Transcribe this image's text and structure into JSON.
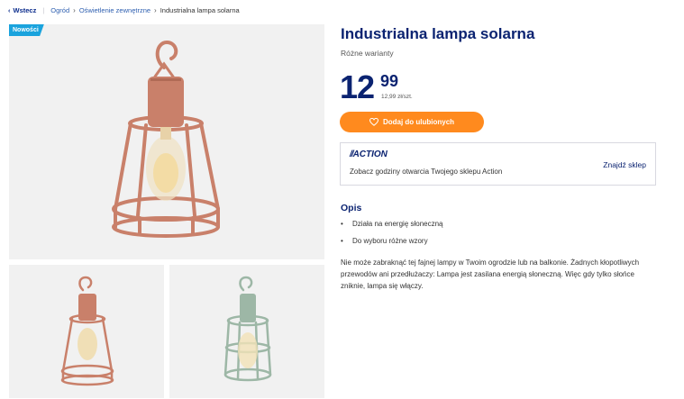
{
  "breadcrumb": {
    "back_label": "Wstecz",
    "items": [
      "Ogród",
      "Oświetlenie zewnętrzne"
    ],
    "current": "Industrialna lampa solarna"
  },
  "gallery": {
    "badge": "Nowości",
    "main_alt": "Industrial solar lamp, terracotta",
    "thumbs": [
      "terracotta variant",
      "sage green variant"
    ]
  },
  "product": {
    "title": "Industrialna lampa solarna",
    "variants": "Różne warianty",
    "price_whole": "12",
    "price_cents": "99",
    "unit_price": "12,99 zł/szt.",
    "favorite_label": "Dodaj do ulubionych"
  },
  "store": {
    "logo": "ACTION",
    "text": "Zobacz godziny otwarcia Twojego sklepu Action",
    "link": "Znajdź sklep"
  },
  "description": {
    "heading": "Opis",
    "bullets": [
      "Działa na energię słoneczną",
      "Do wyboru różne wzory"
    ],
    "text": "Nie może zabraknąć tej fajnej lampy w Twoim ogrodzie lub na balkonie. Żadnych kłopotliwych przewodów ani przedłużaczy: Lampa jest zasilana energią słoneczną. Więc gdy tylko słońce zniknie, lampa się włączy."
  },
  "colors": {
    "brand_navy": "#0b2371",
    "accent_orange": "#ff8a1e",
    "badge_blue": "#1aa3dd",
    "lamp_terracotta": "#c9806a",
    "lamp_green": "#9db7a6"
  }
}
